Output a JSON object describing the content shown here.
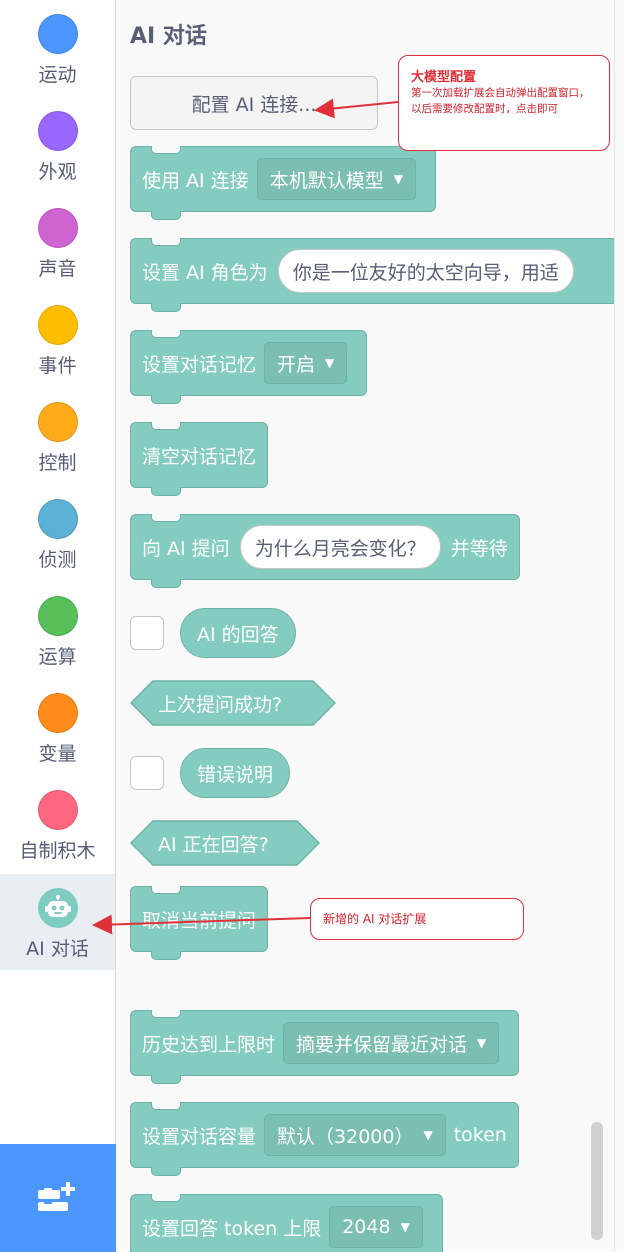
{
  "sidebar": {
    "categories": [
      {
        "label": "运动",
        "color": "#4c97ff"
      },
      {
        "label": "外观",
        "color": "#9966ff"
      },
      {
        "label": "声音",
        "color": "#cf63cf"
      },
      {
        "label": "事件",
        "color": "#ffbf00"
      },
      {
        "label": "控制",
        "color": "#ffab19"
      },
      {
        "label": "侦测",
        "color": "#5cb1d6"
      },
      {
        "label": "运算",
        "color": "#59c059"
      },
      {
        "label": "变量",
        "color": "#ff8c1a"
      },
      {
        "label": "自制积木",
        "color": "#ff6680"
      },
      {
        "label": "AI 对话",
        "color": "#7fcdc0",
        "icon": "robot-icon",
        "selected": true
      }
    ],
    "extension_button": {
      "icon": "add-extension-icon",
      "color": "#4c97ff"
    }
  },
  "palette": {
    "title": "AI 对话",
    "config_button": "配置 AI 连接...",
    "blocks": {
      "use_connection": {
        "label": "使用 AI 连接",
        "dropdown": "本机默认模型"
      },
      "set_role": {
        "label": "设置 AI 角色为",
        "input": "你是一位友好的太空向导，用适"
      },
      "set_memory": {
        "label": "设置对话记忆",
        "dropdown": "开启"
      },
      "clear_memory": {
        "label": "清空对话记忆"
      },
      "ask": {
        "label": "向 AI 提问",
        "input": "为什么月亮会变化？",
        "suffix": "并等待"
      },
      "answer_reporter": {
        "label": "AI 的回答"
      },
      "last_success": {
        "label": "上次提问成功?"
      },
      "error_reporter": {
        "label": "错误说明"
      },
      "answering": {
        "label": "AI 正在回答?"
      },
      "cancel": {
        "label": "取消当前提问"
      },
      "history_limit": {
        "label": "历史达到上限时",
        "dropdown": "摘要并保留最近对话"
      },
      "capacity": {
        "label": "设置对话容量",
        "dropdown": "默认（32000）",
        "suffix": "token"
      },
      "answer_limit": {
        "label": "设置回答 token 上限",
        "dropdown": "2048"
      }
    },
    "block_color": "#84ccbf"
  },
  "annotations": {
    "model_config": {
      "title": "大模型配置",
      "body": "第一次加载扩展会自动弹出配置窗口，以后需要修改配置时，点击即可"
    },
    "new_extension": {
      "title": "新增的 AI 对话扩展"
    },
    "color": "#e0303a"
  }
}
